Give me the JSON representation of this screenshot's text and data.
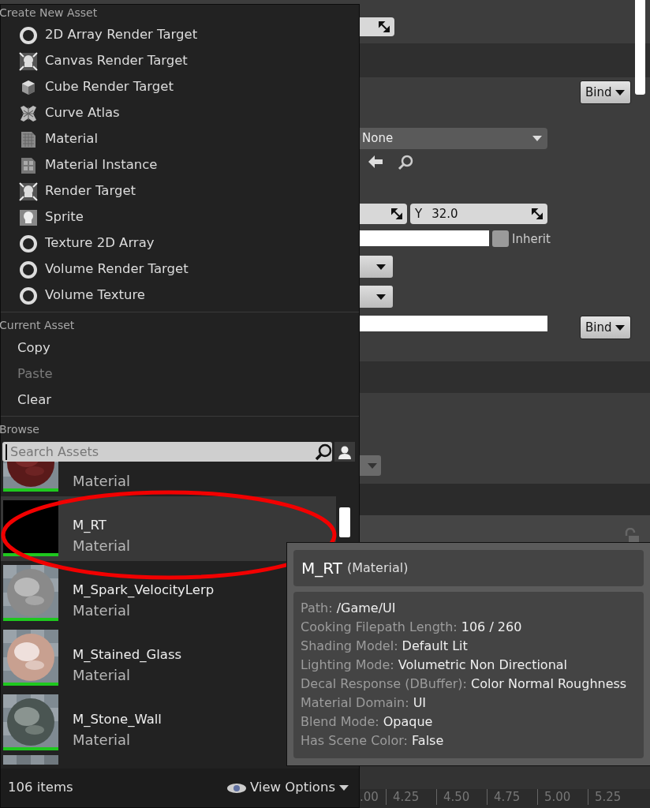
{
  "details_panel": {
    "bind_buttons": [
      "Bind",
      "Bind"
    ],
    "brush_dropdown": {
      "value": "None"
    },
    "size_field": {
      "axis": "Y",
      "value": "32.0"
    },
    "inherit_checkbox": {
      "label": "Inherit",
      "checked": false
    }
  },
  "timeline": {
    "ticks": [
      ".00",
      "4.25",
      "4.50",
      "4.75",
      "5.00",
      "5.25"
    ]
  },
  "asset_menu": {
    "create_new_asset": {
      "heading": "Create New Asset",
      "items": [
        {
          "label": "2D Array Render Target",
          "kind": "ring"
        },
        {
          "label": "Canvas Render Target",
          "kind": "target"
        },
        {
          "label": "Cube Render Target",
          "kind": "cube"
        },
        {
          "label": "Curve Atlas",
          "kind": "atlas"
        },
        {
          "label": "Material",
          "kind": "material"
        },
        {
          "label": "Material Instance",
          "kind": "instance"
        },
        {
          "label": "Render Target",
          "kind": "target"
        },
        {
          "label": "Sprite",
          "kind": "sprite"
        },
        {
          "label": "Texture 2D Array",
          "kind": "ring"
        },
        {
          "label": "Volume Render Target",
          "kind": "ring"
        },
        {
          "label": "Volume Texture",
          "kind": "ring"
        }
      ]
    },
    "current_asset": {
      "heading": "Current Asset",
      "items": [
        {
          "label": "Copy",
          "disabled": false
        },
        {
          "label": "Paste",
          "disabled": true
        },
        {
          "label": "Clear",
          "disabled": false
        }
      ]
    },
    "browse": {
      "heading": "Browse",
      "search": {
        "placeholder": "Search Assets"
      },
      "assets": [
        {
          "type": "Material",
          "selected": false
        },
        {
          "name": "M_RT",
          "type": "Material",
          "selected": true
        },
        {
          "name": "M_Spark_VelocityLerp",
          "type": "Material",
          "selected": false
        },
        {
          "name": "M_Stained_Glass",
          "type": "Material",
          "selected": false
        },
        {
          "name": "M_Stone_Wall",
          "type": "Material",
          "selected": false
        }
      ],
      "item_count": "106 items",
      "view_options": "View Options"
    }
  },
  "tooltip": {
    "title": "M_RT",
    "type": "(Material)",
    "properties": [
      {
        "label": "Path:",
        "value": "/Game/UI"
      },
      {
        "label": "Cooking Filepath Length:",
        "value": "106 / 260"
      },
      {
        "label": "Shading Model:",
        "value": "Default Lit"
      },
      {
        "label": "Lighting Mode:",
        "value": "Volumetric Non Directional"
      },
      {
        "label": "Decal Response (DBuffer):",
        "value": "Color Normal Roughness"
      },
      {
        "label": "Material Domain:",
        "value": "UI"
      },
      {
        "label": "Blend Mode:",
        "value": "Opaque"
      },
      {
        "label": "Has Scene Color:",
        "value": "False"
      }
    ]
  }
}
